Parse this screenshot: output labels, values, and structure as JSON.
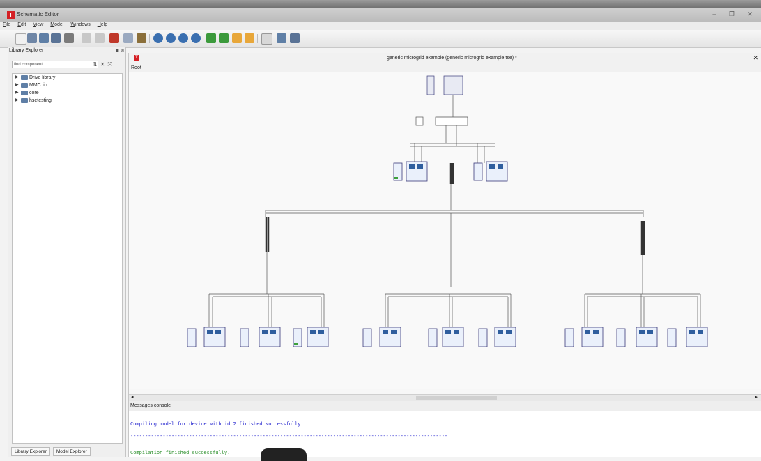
{
  "app": {
    "title": "Schematic Editor",
    "logo_text": "T"
  },
  "window_controls": [
    "–",
    "❐",
    "✕"
  ],
  "menu": [
    "File",
    "Edit",
    "View",
    "Model",
    "Windows",
    "Help"
  ],
  "library_explorer": {
    "title": "Library Explorer",
    "header_buttons": "▣ ⊠",
    "search_placeholder": "find component",
    "tree": [
      "Drive library",
      "MMC lib",
      "core",
      "hsetesting"
    ]
  },
  "bottom_tabs": [
    "Library Explorer",
    "Model Explorer"
  ],
  "document": {
    "logo_text": "T",
    "title": "generic microgrid example (generic microgrid example.tse) *",
    "close": "✕",
    "breadcrumb": "Root"
  },
  "console": {
    "title": "Messages console",
    "lines": [
      "Compiling model for device with id 2 finished successfully",
      "------------------------------------------------------------------------------------------------------------",
      "Compilation finished successfully."
    ]
  },
  "colors": {
    "accent": "#d42025",
    "info_text": "#1a1acc",
    "success_text": "#2a8f2a"
  }
}
